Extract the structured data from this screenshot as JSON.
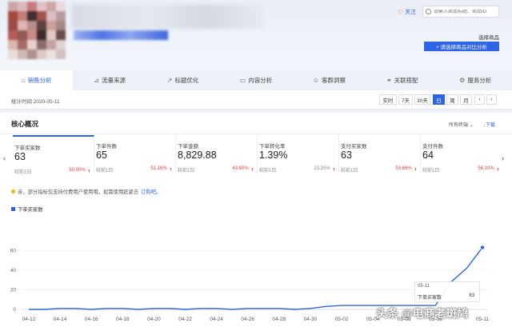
{
  "header": {
    "follow_label": "关注",
    "search_placeholder": "请输入商品标题、商品ID",
    "select_goods_label": "选择商品",
    "compare_button_label": "+ 请选择商品对比分析",
    "accent": "#2d63e6"
  },
  "tabs": [
    {
      "label": "销售分析",
      "icon": "home-icon",
      "active": true
    },
    {
      "label": "流量来源",
      "icon": "chart-icon",
      "active": false
    },
    {
      "label": "标题优化",
      "icon": "trend-icon",
      "active": false
    },
    {
      "label": "内容分析",
      "icon": "doc-icon",
      "active": false
    },
    {
      "label": "客群洞察",
      "icon": "user-icon",
      "active": false
    },
    {
      "label": "关联搭配",
      "icon": "link-icon",
      "active": false
    },
    {
      "label": "服务分析",
      "icon": "service-icon",
      "active": false
    }
  ],
  "stats": {
    "time_label": "统计时间 2020-05-11",
    "ranges": [
      "实时",
      "7天",
      "30天",
      "日",
      "周",
      "月"
    ],
    "active_range": "日",
    "prev_icon": "chevron-left-icon",
    "next_icon": "chevron-right-icon"
  },
  "core": {
    "title": "核心概况",
    "all_terms_label": "所有终端",
    "download_label": "下载",
    "metrics": [
      {
        "name": "下单买家数",
        "value": "63",
        "compare": "较前1日",
        "pct": "50.00%"
      },
      {
        "name": "下单件数",
        "value": "65",
        "compare": "较前1日",
        "pct": "51.16%"
      },
      {
        "name": "下单金额",
        "value": "8,829.88",
        "compare": "较前1日",
        "pct": "43.60%"
      },
      {
        "name": "下单转化率",
        "value": "1.39%",
        "compare": "较前1日",
        "pct": "23.35%"
      },
      {
        "name": "支付买家数",
        "value": "63",
        "compare": "较前1日",
        "pct": "53.66%"
      },
      {
        "name": "支付件数",
        "value": "64",
        "compare": "较前1日",
        "pct": "56.10%"
      }
    ],
    "notice_text": "亲，部分指标仅支持付费用户使用哦，如需使用赶紧去",
    "notice_link": "订购吧。"
  },
  "chart_data": {
    "type": "line",
    "series": [
      {
        "name": "下单买家数",
        "color": "#2d63e6"
      }
    ],
    "x": [
      "04-12",
      "04-13",
      "04-14",
      "04-15",
      "04-16",
      "04-17",
      "04-18",
      "04-19",
      "04-20",
      "04-21",
      "04-22",
      "04-23",
      "04-24",
      "04-25",
      "04-26",
      "04-27",
      "04-28",
      "04-29",
      "04-30",
      "05-01",
      "05-02",
      "05-03",
      "05-04",
      "05-05",
      "05-06",
      "05-07",
      "05-08",
      "05-09",
      "05-10",
      "05-11"
    ],
    "y": [
      0,
      0,
      1,
      1,
      0,
      1,
      1,
      0,
      1,
      1,
      0,
      1,
      1,
      0,
      1,
      1,
      1,
      0,
      1,
      3,
      4,
      4,
      4,
      4,
      4,
      4,
      4,
      28,
      42,
      63
    ],
    "tick_labels": [
      "04-12",
      "04-14",
      "04-16",
      "04-18",
      "04-20",
      "04-22",
      "04-24",
      "04-26",
      "04-28",
      "04-30",
      "05-02",
      "05-04",
      "05-06",
      "05-08",
      "05-11"
    ],
    "yticks": [
      0,
      20,
      40,
      60
    ],
    "ylim": [
      0,
      70
    ],
    "tooltip": {
      "date": "05-11",
      "name": "下单买家数",
      "value": "63"
    }
  },
  "watermark": "头条 @电商老斑鸠"
}
